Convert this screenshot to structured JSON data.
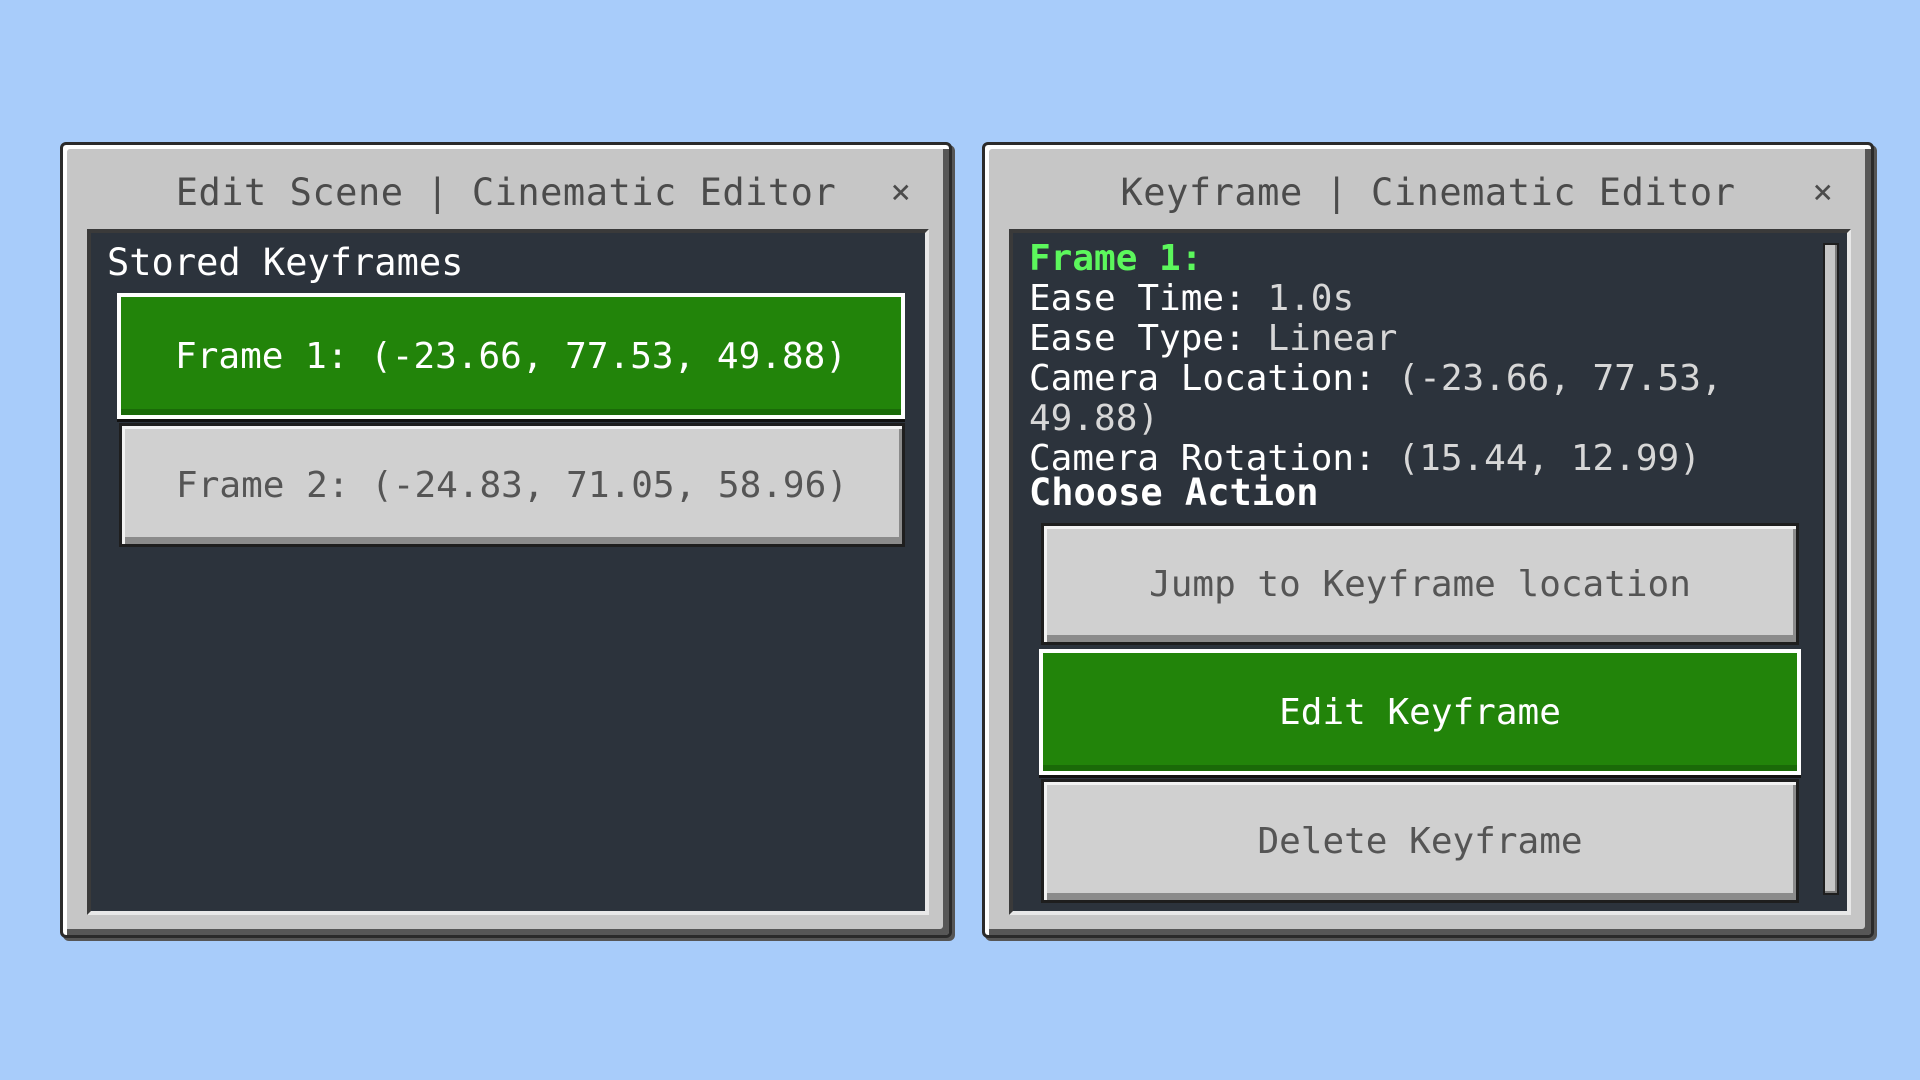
{
  "left_window": {
    "title": "Edit Scene | Cinematic Editor",
    "close_glyph": "×",
    "section_label": "Stored Keyframes",
    "keyframes": [
      {
        "label": "Frame 1: (-23.66, 77.53, 49.88)",
        "selected": true
      },
      {
        "label": "Frame 2: (-24.83, 71.05, 58.96)",
        "selected": false
      }
    ]
  },
  "right_window": {
    "title": "Keyframe | Cinematic Editor",
    "close_glyph": "×",
    "frame_heading": "Frame 1:",
    "details": [
      {
        "label": "Ease Time:",
        "value": "1.0s"
      },
      {
        "label": "Ease Type:",
        "value": "Linear"
      },
      {
        "label": "Camera Location:",
        "value": "(-23.66, 77.53, 49.88)"
      },
      {
        "label": "Camera Rotation:",
        "value": "(15.44, 12.99)"
      }
    ],
    "choose_label": "Choose Action",
    "actions": {
      "jump": "Jump to Keyframe location",
      "edit": "Edit Keyframe",
      "delete": "Delete Keyframe"
    }
  },
  "colors": {
    "background": "#a8ccfa",
    "panel": "#2c333c",
    "window": "#c6c6c6",
    "button_green": "#22840a",
    "button_gray": "#d0d0d0",
    "frame_heading": "#5cf75c"
  },
  "icons": {
    "close": "close-icon"
  }
}
